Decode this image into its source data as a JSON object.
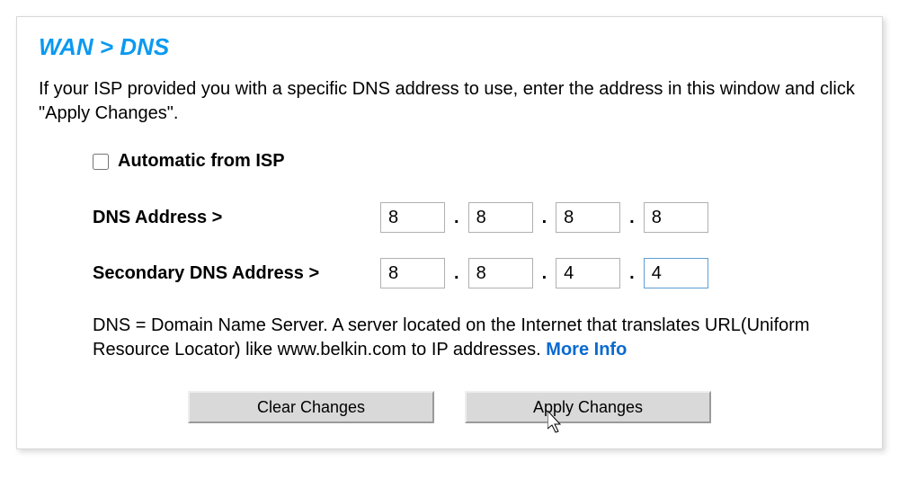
{
  "title": "WAN > DNS",
  "intro": "If your ISP provided you with a specific DNS address to use, enter the address in this window and click \"Apply Changes\".",
  "checkbox": {
    "label": "Automatic from ISP",
    "checked": false
  },
  "rows": {
    "primary": {
      "label": "DNS Address >",
      "octets": [
        "8",
        "8",
        "8",
        "8"
      ]
    },
    "secondary": {
      "label": "Secondary DNS Address >",
      "octets": [
        "8",
        "8",
        "4",
        "4"
      ]
    }
  },
  "footnote_text": "DNS = Domain Name Server. A server located on the Internet that translates URL(Uniform Resource Locator) like www.belkin.com to IP addresses. ",
  "more_link": "More Info",
  "buttons": {
    "clear": "Clear Changes",
    "apply": "Apply Changes"
  }
}
